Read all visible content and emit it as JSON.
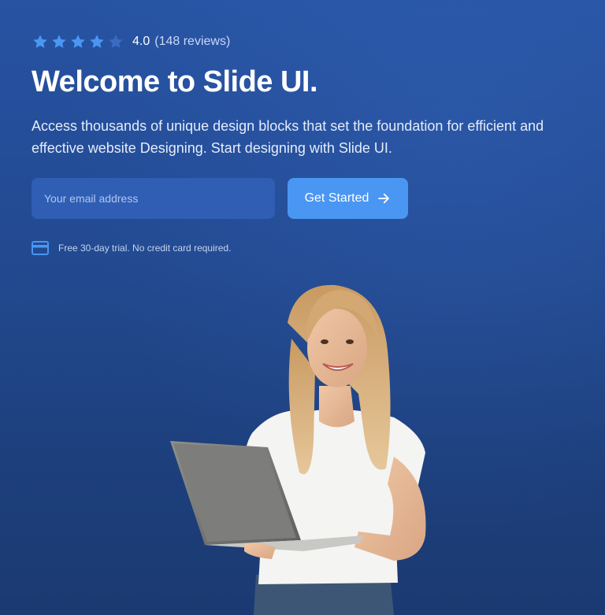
{
  "rating": {
    "stars_filled": 4,
    "stars_total": 5,
    "score": "4.0",
    "count": "(148 reviews)",
    "star_color": "#4a96f3"
  },
  "hero": {
    "title": "Welcome to Slide UI.",
    "description": "Access thousands of unique design blocks that set the foundation for efficient and effective website Designing. Start designing with Slide UI."
  },
  "form": {
    "email_placeholder": "Your email address",
    "cta_label": "Get Started"
  },
  "note": {
    "icon": "credit-card-icon",
    "text": "Free 30-day trial. No credit card required."
  },
  "colors": {
    "accent": "#4a96f3",
    "background_top": "#2753a3",
    "background_bottom": "#1b3a72"
  }
}
